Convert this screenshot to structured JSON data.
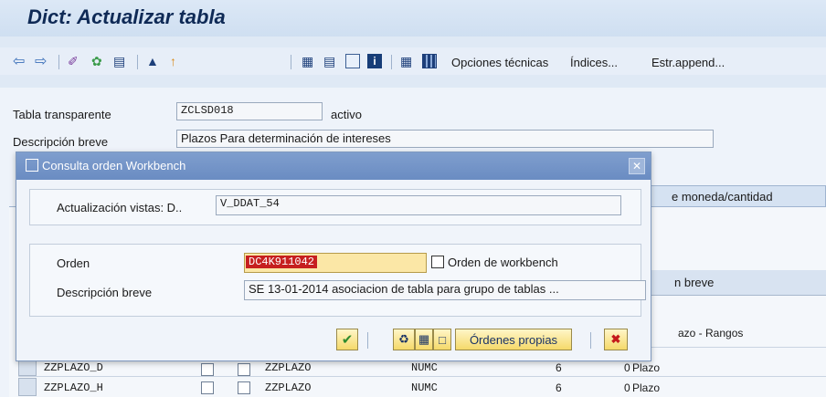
{
  "window": {
    "title": "Dict: Actualizar tabla"
  },
  "toolbar": {
    "icons": [
      "back-arrow-icon",
      "forward-arrow-icon",
      "glasses-icon",
      "object-icon",
      "hierarchy-icon",
      "where-used-icon",
      "pin-icon",
      "structure-icon",
      "table-icon",
      "screen-icon",
      "info-icon",
      "layout-icon",
      "grid-icon"
    ],
    "technical_options": "Opciones técnicas",
    "indexes": "Índices...",
    "append_structure": "Estr.append..."
  },
  "header": {
    "table_label": "Tabla transparente",
    "table_value": "ZCLSD018",
    "status": "activo",
    "description_label": "Descripción breve",
    "description_value": "Plazos Para determinación de intereses"
  },
  "background": {
    "tab_currency": "e moneda/cantidad",
    "column_header": "n breve",
    "rows": [
      {
        "field": "",
        "element": "",
        "type": "",
        "length": "",
        "decimals": "",
        "description": "azo - Rangos"
      },
      {
        "field": "ZZPLAZO_D",
        "element": "ZZPLAZO",
        "type": "NUMC",
        "length": "6",
        "decimals": "0",
        "description": "Plazo"
      },
      {
        "field": "ZZPLAZO_H",
        "element": "ZZPLAZO",
        "type": "NUMC",
        "length": "6",
        "decimals": "0",
        "description": "Plazo"
      }
    ]
  },
  "dialog": {
    "title": "Consulta orden Workbench",
    "maintenance_label": "Actualización vistas: D..",
    "maintenance_value": "V_DDAT_54",
    "order_label": "Orden",
    "order_value": "DC4K911042",
    "order_type": "Orden de workbench",
    "description_label": "Descripción breve",
    "description_value": "SE 13-01-2014 asociacion de tabla para grupo de tablas ...",
    "own_orders_button": "Órdenes propias"
  }
}
